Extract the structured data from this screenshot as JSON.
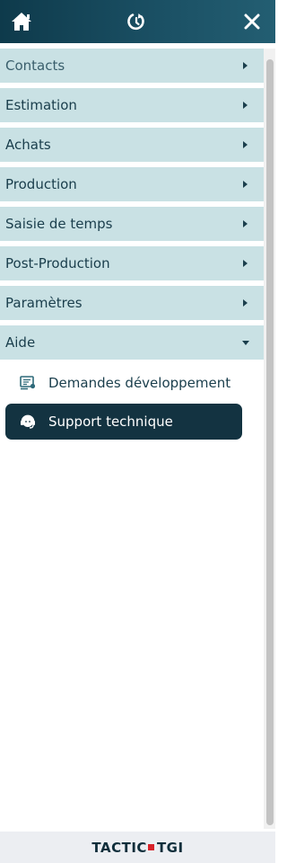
{
  "menu": {
    "items": [
      {
        "label": "Contacts"
      },
      {
        "label": "Estimation"
      },
      {
        "label": "Achats"
      },
      {
        "label": "Production"
      },
      {
        "label": "Saisie de temps"
      },
      {
        "label": "Post-Production"
      },
      {
        "label": "Paramètres"
      },
      {
        "label": "Aide"
      }
    ],
    "aide_children": [
      {
        "label": "Demandes développement",
        "icon": "development-request-icon"
      },
      {
        "label": "Support technique",
        "icon": "headset-icon"
      }
    ]
  },
  "footer": {
    "logo_left": "TACTIC",
    "logo_right": "TGI"
  },
  "colors": {
    "topbar": "#133341",
    "menu_item_bg": "#c9e1e4",
    "active_bg": "#133341",
    "text": "#1a3e4c",
    "logo_mark": "#d8232a"
  }
}
